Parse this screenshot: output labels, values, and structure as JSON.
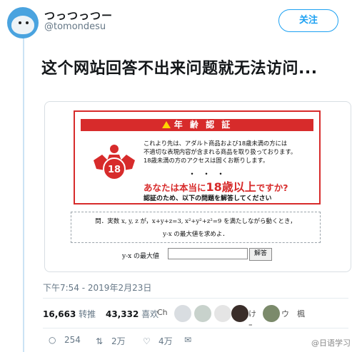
{
  "profile": {
    "display_name": "つっつっつー",
    "handle": "@tomondesu",
    "follow_label": "关注"
  },
  "tweet": {
    "text": "这个网站回答不出来问题就无法访问...",
    "timestamp": "下午7:54 - 2019年2月23日"
  },
  "embedded_page": {
    "warning_header": "年 齢 認 証",
    "badge_number": "18",
    "notice_lines": [
      "これより先は、アダルト商品および18歳未満の方には",
      "不適切な表現内容が含まれる商品を取り扱っております。",
      "18歳未満の方のアクセスは固くお断りします。"
    ],
    "dots": "・・・",
    "question_prefix": "あなたは本当に",
    "question_big": "18歳以上",
    "question_suffix": "ですか?",
    "instruction": "認証のため、以下の問題を解答してください",
    "problem_line1": "問．実数 x, y, z が，x+y+z=3, x²+y²+z²=9 を満たしながら動くとき，",
    "problem_line2": "y-x の最大値を求めよ．",
    "answer_label": "y-x の最大値",
    "answer_value": "",
    "answer_button": "解答"
  },
  "stats": {
    "retweets_count": "16,663",
    "retweets_label": "转推",
    "likes_count": "43,332",
    "likes_label": "喜欢"
  },
  "likers": [
    "Ch",
    "けｰ",
    "ウ",
    "楓"
  ],
  "actions": {
    "reply_count": "254",
    "retweet_count": "2万",
    "like_count": "4万"
  },
  "watermark": "@日语学习",
  "colors": {
    "accent": "#1da1f2",
    "warning_red": "#d72b2b",
    "text_secondary": "#657786"
  }
}
